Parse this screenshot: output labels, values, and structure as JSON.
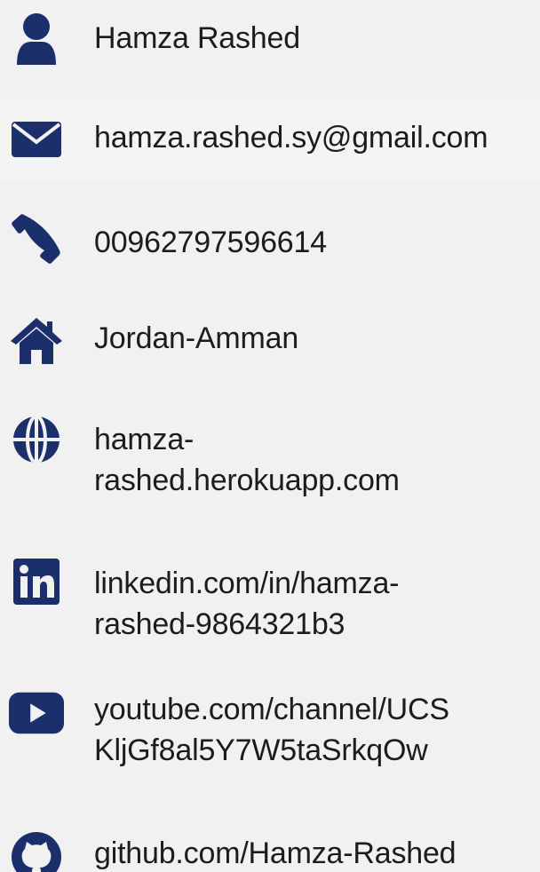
{
  "theme": {
    "icon_color": "#1b2f6b",
    "text_color": "#1c1c1c",
    "background": "#f1f1f1"
  },
  "contacts": [
    {
      "id": "name",
      "icon": "user-icon",
      "lines": [
        "Hamza Rashed"
      ]
    },
    {
      "id": "email",
      "icon": "envelope-icon",
      "lines": [
        "hamza.rashed.sy@gmail.com"
      ]
    },
    {
      "id": "phone",
      "icon": "phone-icon",
      "lines": [
        "00962797596614"
      ]
    },
    {
      "id": "location",
      "icon": "home-icon",
      "lines": [
        "Jordan-Amman"
      ]
    },
    {
      "id": "website",
      "icon": "globe-icon",
      "lines": [
        "hamza-",
        "rashed.herokuapp.com"
      ]
    },
    {
      "id": "linkedin",
      "icon": "linkedin-icon",
      "lines": [
        "linkedin.com/in/hamza-",
        "rashed-9864321b3"
      ]
    },
    {
      "id": "youtube",
      "icon": "youtube-icon",
      "lines": [
        "youtube.com/channel/UCS",
        "KljGf8al5Y7W5taSrkqOw"
      ]
    },
    {
      "id": "github",
      "icon": "github-icon",
      "lines": [
        "github.com/Hamza-Rashed"
      ]
    }
  ]
}
